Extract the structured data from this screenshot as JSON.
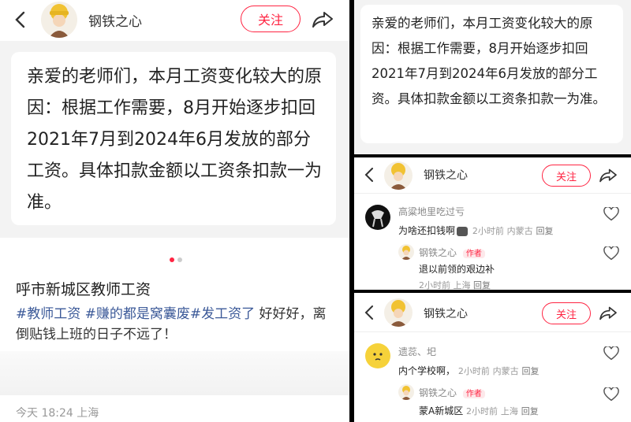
{
  "author": {
    "name": "钢铁之心",
    "follow_label": "关注"
  },
  "post": {
    "body": "亲爱的老师们，本月工资变化较大的原因：根据工作需要，8月开始逐步扣回2021年7月到2024年6月发放的部分工资。具体扣款金额以工资条扣款一为准。",
    "title": "呼市新城区教师工资",
    "tags": [
      "#教师工资",
      "#赚的都是窝囊废",
      "#发工资了"
    ],
    "text_after_tags": " 好好好，离倒贴钱上班的日子不远了！",
    "time": "今天 18:24",
    "location": "上海"
  },
  "comments_1": {
    "c1": {
      "name": "高粱地里吃过亏",
      "text": "为啥还扣钱啊",
      "time": "2小时前",
      "location": "内蒙古",
      "reply": "回复"
    },
    "r1": {
      "name": "钢铁之心",
      "tag": "作者",
      "text": "退以前领的艰边补",
      "time": "2小时前",
      "location": "上海",
      "reply": "回复"
    }
  },
  "comments_2": {
    "c1": {
      "name": "遗蕊、圯",
      "text": "内个学校啊，",
      "time": "2小时前",
      "location": "内蒙古",
      "reply": "回复"
    },
    "r1": {
      "name": "钢铁之心",
      "tag": "作者",
      "text": "蒙A新城区",
      "time": "2小时前",
      "location": "上海",
      "reply": "回复"
    }
  },
  "colors": {
    "accent": "#ff2442",
    "tag_blue": "#3b5998",
    "gray_bg": "#f3f3f3"
  }
}
